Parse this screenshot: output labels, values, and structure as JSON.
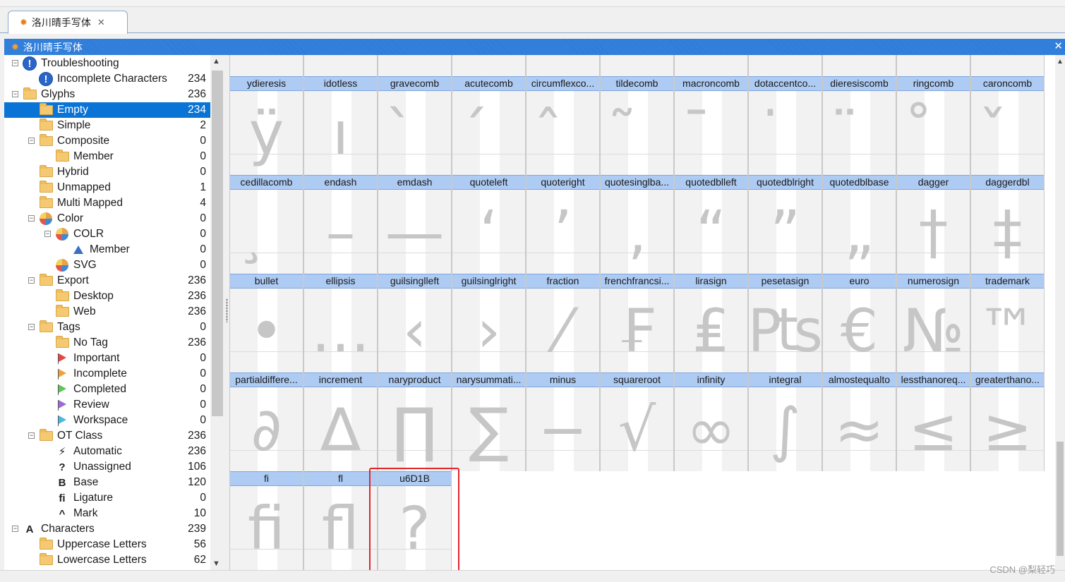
{
  "window": {
    "tab_title": "洛川晴手写体",
    "panel_title": "洛川晴手写体"
  },
  "tree": [
    {
      "label": "Troubleshooting",
      "count": "",
      "level": 0,
      "expander": "minus",
      "icon": "warning-icon"
    },
    {
      "label": "Incomplete Characters",
      "count": "234",
      "level": 1,
      "expander": "",
      "icon": "warning-icon"
    },
    {
      "label": "Glyphs",
      "count": "236",
      "level": 0,
      "expander": "minus",
      "icon": "folder-icon"
    },
    {
      "label": "Empty",
      "count": "234",
      "level": 1,
      "expander": "",
      "icon": "folder-icon",
      "selected": true
    },
    {
      "label": "Simple",
      "count": "2",
      "level": 1,
      "expander": "",
      "icon": "folder-icon"
    },
    {
      "label": "Composite",
      "count": "0",
      "level": 1,
      "expander": "minus",
      "icon": "folder-icon"
    },
    {
      "label": "Member",
      "count": "0",
      "level": 2,
      "expander": "",
      "icon": "folder-icon"
    },
    {
      "label": "Hybrid",
      "count": "0",
      "level": 1,
      "expander": "",
      "icon": "folder-icon"
    },
    {
      "label": "Unmapped",
      "count": "1",
      "level": 1,
      "expander": "",
      "icon": "folder-icon"
    },
    {
      "label": "Multi Mapped",
      "count": "4",
      "level": 1,
      "expander": "",
      "icon": "folder-icon"
    },
    {
      "label": "Color",
      "count": "0",
      "level": 1,
      "expander": "minus",
      "icon": "color-pie-icon"
    },
    {
      "label": "COLR",
      "count": "0",
      "level": 2,
      "expander": "minus",
      "icon": "color-pie-icon"
    },
    {
      "label": "Member",
      "count": "0",
      "level": 3,
      "expander": "",
      "icon": "triangle-icon"
    },
    {
      "label": "SVG",
      "count": "0",
      "level": 2,
      "expander": "",
      "icon": "color-pie-icon"
    },
    {
      "label": "Export",
      "count": "236",
      "level": 1,
      "expander": "minus",
      "icon": "folder-icon"
    },
    {
      "label": "Desktop",
      "count": "236",
      "level": 2,
      "expander": "",
      "icon": "folder-icon"
    },
    {
      "label": "Web",
      "count": "236",
      "level": 2,
      "expander": "",
      "icon": "folder-icon"
    },
    {
      "label": "Tags",
      "count": "0",
      "level": 1,
      "expander": "minus",
      "icon": "folder-icon"
    },
    {
      "label": "No Tag",
      "count": "236",
      "level": 2,
      "expander": "",
      "icon": "folder-icon"
    },
    {
      "label": "Important",
      "count": "0",
      "level": 2,
      "expander": "",
      "icon": "flag-red-icon"
    },
    {
      "label": "Incomplete",
      "count": "0",
      "level": 2,
      "expander": "",
      "icon": "flag-orange-icon"
    },
    {
      "label": "Completed",
      "count": "0",
      "level": 2,
      "expander": "",
      "icon": "flag-green-icon"
    },
    {
      "label": "Review",
      "count": "0",
      "level": 2,
      "expander": "",
      "icon": "flag-purple-icon"
    },
    {
      "label": "Workspace",
      "count": "0",
      "level": 2,
      "expander": "",
      "icon": "flag-cyan-icon"
    },
    {
      "label": "OT Class",
      "count": "236",
      "level": 1,
      "expander": "minus",
      "icon": "folder-icon"
    },
    {
      "label": "Automatic",
      "count": "236",
      "level": 2,
      "expander": "",
      "icon": "lightning-icon"
    },
    {
      "label": "Unassigned",
      "count": "106",
      "level": 2,
      "expander": "",
      "icon": "question-icon"
    },
    {
      "label": "Base",
      "count": "120",
      "level": 2,
      "expander": "",
      "icon": "base-b-icon"
    },
    {
      "label": "Ligature",
      "count": "0",
      "level": 2,
      "expander": "",
      "icon": "ligature-fi-icon"
    },
    {
      "label": "Mark",
      "count": "10",
      "level": 2,
      "expander": "",
      "icon": "caret-mark-icon"
    },
    {
      "label": "Characters",
      "count": "239",
      "level": 0,
      "expander": "minus",
      "icon": "letter-a-icon"
    },
    {
      "label": "Uppercase Letters",
      "count": "56",
      "level": 1,
      "expander": "",
      "icon": "folder-icon"
    },
    {
      "label": "Lowercase Letters",
      "count": "62",
      "level": 1,
      "expander": "",
      "icon": "folder-icon"
    }
  ],
  "icon_glyphs": {
    "lightning-icon": "⚡",
    "question-icon": "?",
    "base-b-icon": "B",
    "ligature-fi-icon": "ﬁ",
    "caret-mark-icon": "^",
    "letter-a-icon": "A"
  },
  "flag_colors": {
    "flag-red-icon": "#e84545",
    "flag-orange-icon": "#f0a23a",
    "flag-green-icon": "#5cc75a",
    "flag-purple-icon": "#9b6ad8",
    "flag-cyan-icon": "#4ab8e0"
  },
  "glyph_rows": [
    [
      {
        "name": "ydieresis",
        "glyph": "ÿ"
      },
      {
        "name": "idotless",
        "glyph": "ı"
      },
      {
        "name": "gravecomb",
        "glyph": "̀"
      },
      {
        "name": "acutecomb",
        "glyph": "́"
      },
      {
        "name": "circumflexco...",
        "glyph": "̂"
      },
      {
        "name": "tildecomb",
        "glyph": "̃"
      },
      {
        "name": "macroncomb",
        "glyph": "̄"
      },
      {
        "name": "dotaccentco...",
        "glyph": "̇"
      },
      {
        "name": "dieresiscomb",
        "glyph": "̈"
      },
      {
        "name": "ringcomb",
        "glyph": "̊"
      },
      {
        "name": "caroncomb",
        "glyph": "̌"
      }
    ],
    [
      {
        "name": "cedillacomb",
        "glyph": "̧"
      },
      {
        "name": "endash",
        "glyph": "–"
      },
      {
        "name": "emdash",
        "glyph": "—"
      },
      {
        "name": "quoteleft",
        "glyph": "‘"
      },
      {
        "name": "quoteright",
        "glyph": "’"
      },
      {
        "name": "quotesinglba...",
        "glyph": "‚"
      },
      {
        "name": "quotedblleft",
        "glyph": "“"
      },
      {
        "name": "quotedblright",
        "glyph": "”"
      },
      {
        "name": "quotedblbase",
        "glyph": "„"
      },
      {
        "name": "dagger",
        "glyph": "†"
      },
      {
        "name": "daggerdbl",
        "glyph": "‡"
      }
    ],
    [
      {
        "name": "bullet",
        "glyph": "•"
      },
      {
        "name": "ellipsis",
        "glyph": "…"
      },
      {
        "name": "guilsinglleft",
        "glyph": "‹"
      },
      {
        "name": "guilsinglright",
        "glyph": "›"
      },
      {
        "name": "fraction",
        "glyph": "⁄"
      },
      {
        "name": "frenchfrancsi...",
        "glyph": "₣"
      },
      {
        "name": "lirasign",
        "glyph": "₤"
      },
      {
        "name": "pesetasign",
        "glyph": "₧"
      },
      {
        "name": "euro",
        "glyph": "€"
      },
      {
        "name": "numerosign",
        "glyph": "№"
      },
      {
        "name": "trademark",
        "glyph": "™"
      }
    ],
    [
      {
        "name": "partialdiffere...",
        "glyph": "∂"
      },
      {
        "name": "increment",
        "glyph": "∆"
      },
      {
        "name": "naryproduct",
        "glyph": "∏"
      },
      {
        "name": "narysummati...",
        "glyph": "∑"
      },
      {
        "name": "minus",
        "glyph": "−"
      },
      {
        "name": "squareroot",
        "glyph": "√"
      },
      {
        "name": "infinity",
        "glyph": "∞"
      },
      {
        "name": "integral",
        "glyph": "∫"
      },
      {
        "name": "almostequalto",
        "glyph": "≈"
      },
      {
        "name": "lessthanoreq...",
        "glyph": "≤"
      },
      {
        "name": "greaterthano...",
        "glyph": "≥"
      }
    ],
    [
      {
        "name": "fi",
        "glyph": "ﬁ"
      },
      {
        "name": "fl",
        "glyph": "ﬂ"
      },
      {
        "name": "u6D1B",
        "glyph": "?"
      }
    ]
  ],
  "watermark": "CSDN @梨轻巧",
  "colors": {
    "accent": "#2b7bd9",
    "selection": "#0a74d6",
    "cell_header": "#aecbf3",
    "highlight_box": "#e3242b"
  }
}
